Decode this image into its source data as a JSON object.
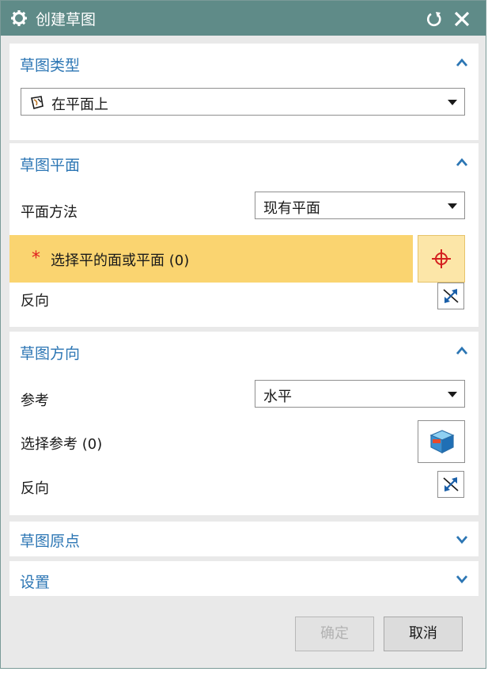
{
  "window": {
    "title": "创建草图",
    "icons": [
      "gear-icon",
      "reset-icon",
      "close-icon"
    ]
  },
  "sections": {
    "type": {
      "title": "草图类型",
      "selected": "在平面上",
      "icon": "sketch-on-plane-icon"
    },
    "plane": {
      "title": "草图平面",
      "method_label": "平面方法",
      "method_value": "现有平面",
      "required_mark": "*",
      "select_label": "选择平的面或平面 (0)",
      "reverse_label": "反向"
    },
    "orientation": {
      "title": "草图方向",
      "ref_label": "参考",
      "ref_value": "水平",
      "select_ref_label": "选择参考 (0)",
      "reverse_label": "反向"
    },
    "origin": {
      "title": "草图原点"
    },
    "settings": {
      "title": "设置"
    }
  },
  "buttons": {
    "ok": "确定",
    "cancel": "取消"
  },
  "colors": {
    "titlebar": "#5f8b88",
    "section_title": "#2c76b4",
    "highlight": "#fad470",
    "crosshair": "#d42020",
    "required": "#e02020"
  }
}
